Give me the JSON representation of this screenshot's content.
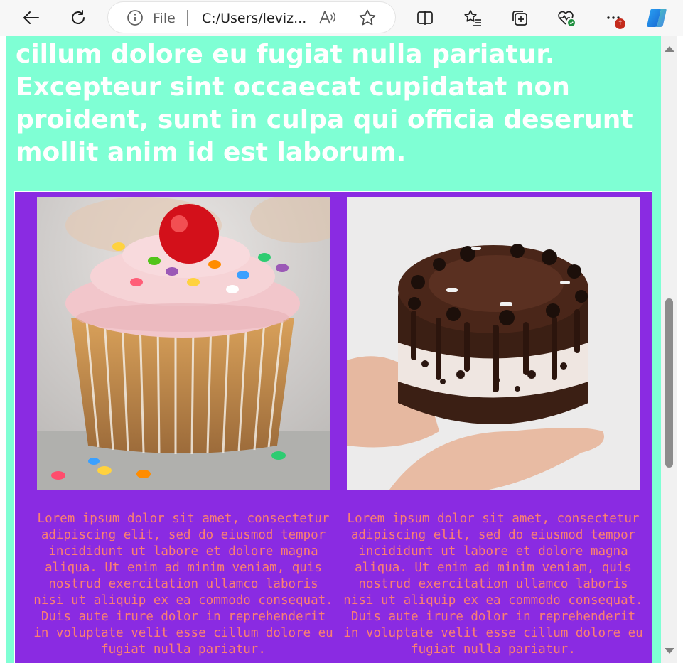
{
  "browser": {
    "address_label": "File",
    "url": "C:/Users/leviz...",
    "notification_badge": "↑",
    "icons": [
      "back-icon",
      "refresh-icon",
      "info-icon",
      "read-aloud-icon",
      "favorite-star-icon",
      "split-screen-icon",
      "favorites-list-icon",
      "collections-icon",
      "browser-essentials-icon",
      "more-icon",
      "copilot-icon"
    ],
    "accent": "#0078d4"
  },
  "page": {
    "background": "#7fffd4",
    "headline": "cillum dolore eu fugiat nulla pariatur. Excepteur sint occaecat cupidatat non proident, sunt in culpa qui officia deserunt mollit anim id est laborum."
  },
  "gallery": {
    "background": "#8a2be2",
    "text_color": "#fa8072",
    "cards": [
      {
        "image": "cupcake",
        "text": "Lorem ipsum dolor sit amet, consectetur adipiscing elit, sed do eiusmod tempor incididunt ut labore et dolore magna aliqua. Ut enim ad minim veniam, quis nostrud exercitation ullamco laboris nisi ut aliquip ex ea commodo consequat. Duis aute irure dolor in reprehenderit in voluptate velit esse cillum dolore eu fugiat nulla pariatur."
      },
      {
        "image": "chocolate-cookie-cake",
        "text": "Lorem ipsum dolor sit amet, consectetur adipiscing elit, sed do eiusmod tempor incididunt ut labore et dolore magna aliqua. Ut enim ad minim veniam, quis nostrud exercitation ullamco laboris nisi ut aliquip ex ea commodo consequat. Duis aute irure dolor in reprehenderit in voluptate velit esse cillum dolore eu fugiat nulla pariatur."
      }
    ]
  }
}
